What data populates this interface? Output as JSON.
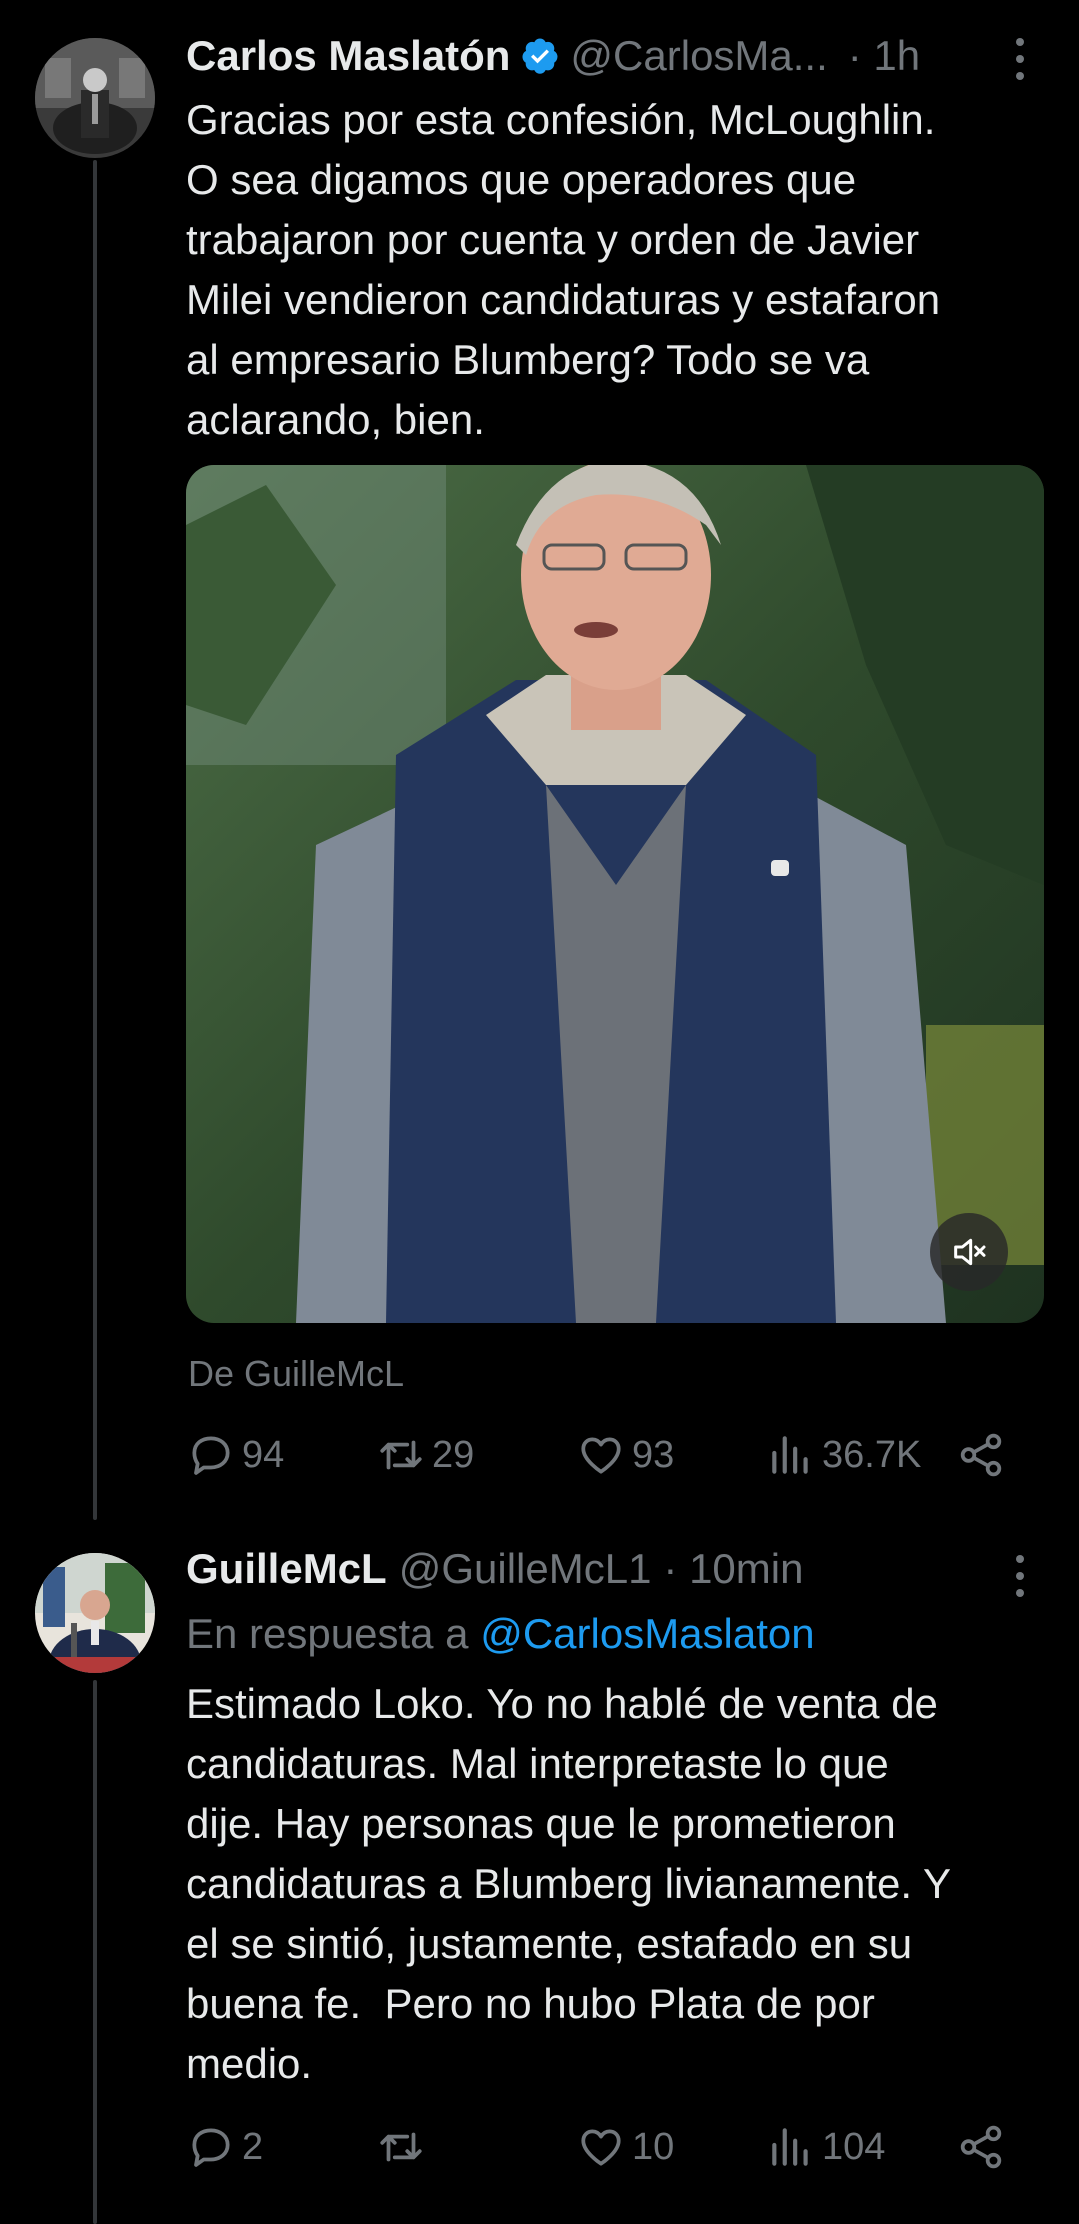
{
  "tweet1": {
    "author_name": "Carlos Maslatón",
    "handle": "@CarlosMa...",
    "time": "· 1h",
    "text": "Gracias por esta confesión, McLoughlin.\nO sea digamos que operadores que\ntrabajaron por cuenta y orden de Javier\nMilei vendieron candidaturas y estafaron\nal empresario Blumberg? Todo se va\naclarando, bien.",
    "media_source": "De GuilleMcL",
    "replies": "94",
    "reposts": "29",
    "likes": "93",
    "views": "36.7K"
  },
  "tweet2": {
    "author_name": "GuilleMcL",
    "handle": "@GuilleMcL1",
    "time": "· 10min",
    "reply_prefix": "En respuesta a ",
    "reply_handle": "@CarlosMaslaton",
    "text": "Estimado Loko. Yo no hablé de venta de\ncandidaturas. Mal interpretaste lo que\ndije. Hay personas que le prometieron\ncandidaturas a Blumberg livianamente. Y\nel se sintió, justamente, estafado en su\nbuena fe.  Pero no hubo Plata de por\nmedio.",
    "replies": "2",
    "reposts": "",
    "likes": "10",
    "views": "104"
  },
  "colors": {
    "background": "#000000",
    "text": "#e7e9ea",
    "secondary": "#71767b",
    "link": "#1d9bf0",
    "verified": "#1d9bf0"
  },
  "icons": [
    "verified-badge-icon",
    "more-icon",
    "reply-icon",
    "repost-icon",
    "like-icon",
    "views-icon",
    "share-icon",
    "mute-icon"
  ]
}
